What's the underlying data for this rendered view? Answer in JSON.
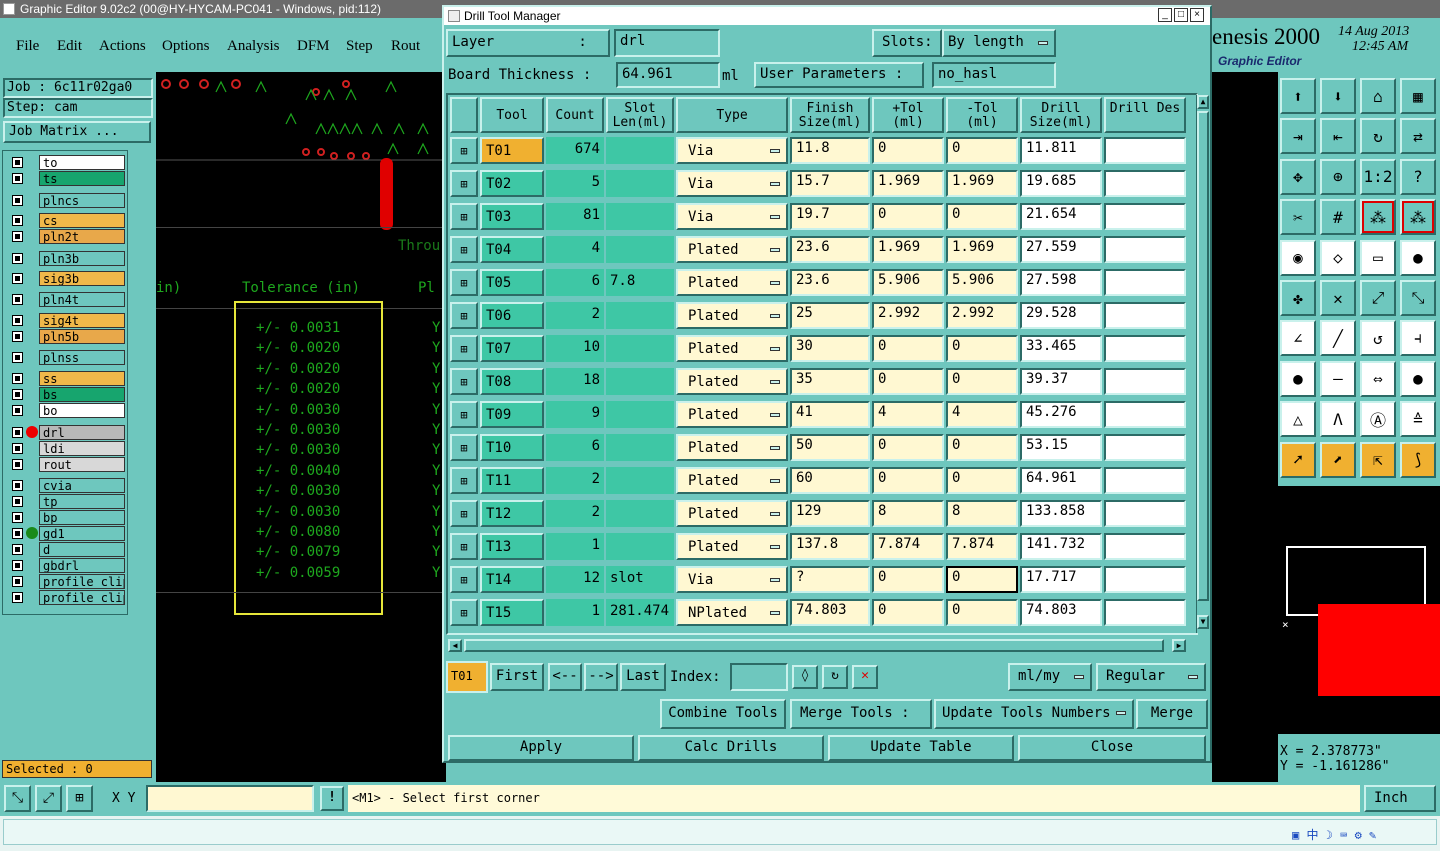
{
  "window": {
    "title": "Graphic Editor 9.02c2 (00@HY-HYCAM-PC041 - Windows, pid:112)"
  },
  "menu": [
    "File",
    "Edit",
    "Actions",
    "Options",
    "Analysis",
    "DFM",
    "Step",
    "Rout"
  ],
  "brand": {
    "name": "enesis 2000",
    "date": "14 Aug 2013",
    "time": "12:45 AM",
    "subtitle": "Graphic Editor"
  },
  "job": {
    "job_label": "Job : 6c11r02ga0",
    "step_label": "Step: cam",
    "matrix_button": "Job Matrix ..."
  },
  "layers": [
    {
      "name": "to",
      "color": "#ffffff"
    },
    {
      "name": "ts",
      "color": "#17a56e"
    },
    {
      "name": "plncs",
      "color": "#6ec7be"
    },
    {
      "name": "cs",
      "color": "#f0b84a"
    },
    {
      "name": "pln2t",
      "color": "#e8a84a"
    },
    {
      "name": "pln3b",
      "color": "#6ec7be"
    },
    {
      "name": "sig3b",
      "color": "#f0b84a"
    },
    {
      "name": "pln4t",
      "color": "#6ec7be"
    },
    {
      "name": "sig4t",
      "color": "#f0b84a"
    },
    {
      "name": "pln5b",
      "color": "#e8a84a"
    },
    {
      "name": "plnss",
      "color": "#6ec7be"
    },
    {
      "name": "ss",
      "color": "#f0b84a"
    },
    {
      "name": "bs",
      "color": "#17a56e"
    },
    {
      "name": "bo",
      "color": "#ffffff"
    },
    {
      "name": "drl",
      "color": "#b8b8b8"
    },
    {
      "name": "ldi",
      "color": "#d8d8d8"
    },
    {
      "name": "rout",
      "color": "#d8d8d8"
    },
    {
      "name": "cvia",
      "color": "#6ec7be"
    },
    {
      "name": "tp",
      "color": "#6ec7be"
    },
    {
      "name": "bp",
      "color": "#6ec7be"
    },
    {
      "name": "gd1",
      "color": "#6ec7be"
    },
    {
      "name": "d",
      "color": "#6ec7be"
    },
    {
      "name": "gbdrl",
      "color": "#6ec7be"
    },
    {
      "name": "profile_clip",
      "color": "#6ec7be"
    },
    {
      "name": "profile_clip",
      "color": "#6ec7be"
    }
  ],
  "selected": "Selected : 0",
  "canvas": {
    "header_left": "in)",
    "header_tol": "Tolerance (in)",
    "header_right": "Pl",
    "throu": "Throu",
    "tolerances": [
      "+/- 0.0031",
      "+/- 0.0020",
      "+/- 0.0020",
      "+/- 0.0020",
      "+/- 0.0030",
      "+/- 0.0030",
      "+/- 0.0030",
      "+/- 0.0040",
      "+/- 0.0030",
      "+/- 0.0030",
      "+/- 0.0080",
      "+/- 0.0079",
      "+/- 0.0059"
    ]
  },
  "dialog": {
    "title": "Drill Tool Manager",
    "layer_label": "Layer          :",
    "layer_value": "drl",
    "slots_label": "Slots:",
    "slots_value": "By length",
    "thickness_label": "Board Thickness :",
    "thickness_value": "64.961",
    "thickness_unit": "ml",
    "user_params_label": "User Parameters :",
    "user_params_value": "no_hasl",
    "columns": [
      "Tool",
      "Count",
      "Slot Len(ml)",
      "Type",
      "Finish Size(ml)",
      "+Tol (ml)",
      "-Tol (ml)",
      "Drill Size(ml)",
      "Drill Des"
    ],
    "rows": [
      {
        "tool": "T01",
        "count": "674",
        "slot": "",
        "type": "Via",
        "finish": "11.8",
        "ptol": "0",
        "mtol": "0",
        "drill": "11.811"
      },
      {
        "tool": "T02",
        "count": "5",
        "slot": "",
        "type": "Via",
        "finish": "15.7",
        "ptol": "1.969",
        "mtol": "1.969",
        "drill": "19.685"
      },
      {
        "tool": "T03",
        "count": "81",
        "slot": "",
        "type": "Via",
        "finish": "19.7",
        "ptol": "0",
        "mtol": "0",
        "drill": "21.654"
      },
      {
        "tool": "T04",
        "count": "4",
        "slot": "",
        "type": "Plated",
        "finish": "23.6",
        "ptol": "1.969",
        "mtol": "1.969",
        "drill": "27.559"
      },
      {
        "tool": "T05",
        "count": "6",
        "slot": "7.8",
        "type": "Plated",
        "finish": "23.6",
        "ptol": "5.906",
        "mtol": "5.906",
        "drill": "27.598"
      },
      {
        "tool": "T06",
        "count": "2",
        "slot": "",
        "type": "Plated",
        "finish": "25",
        "ptol": "2.992",
        "mtol": "2.992",
        "drill": "29.528"
      },
      {
        "tool": "T07",
        "count": "10",
        "slot": "",
        "type": "Plated",
        "finish": "30",
        "ptol": "0",
        "mtol": "0",
        "drill": "33.465"
      },
      {
        "tool": "T08",
        "count": "18",
        "slot": "",
        "type": "Plated",
        "finish": "35",
        "ptol": "0",
        "mtol": "0",
        "drill": "39.37"
      },
      {
        "tool": "T09",
        "count": "9",
        "slot": "",
        "type": "Plated",
        "finish": "41",
        "ptol": "4",
        "mtol": "4",
        "drill": "45.276"
      },
      {
        "tool": "T10",
        "count": "6",
        "slot": "",
        "type": "Plated",
        "finish": "50",
        "ptol": "0",
        "mtol": "0",
        "drill": "53.15"
      },
      {
        "tool": "T11",
        "count": "2",
        "slot": "",
        "type": "Plated",
        "finish": "60",
        "ptol": "0",
        "mtol": "0",
        "drill": "64.961"
      },
      {
        "tool": "T12",
        "count": "2",
        "slot": "",
        "type": "Plated",
        "finish": "129",
        "ptol": "8",
        "mtol": "8",
        "drill": "133.858"
      },
      {
        "tool": "T13",
        "count": "1",
        "slot": "",
        "type": "Plated",
        "finish": "137.8",
        "ptol": "7.874",
        "mtol": "7.874",
        "drill": "141.732"
      },
      {
        "tool": "T14",
        "count": "12",
        "slot": "slot",
        "type": "Via",
        "finish": "?",
        "ptol": "0",
        "mtol": "0",
        "drill": "17.717"
      },
      {
        "tool": "T15",
        "count": "1",
        "slot": "281.474",
        "type": "NPlated",
        "finish": "74.803",
        "ptol": "0",
        "mtol": "0",
        "drill": "74.803"
      }
    ],
    "nav": {
      "current": "T01",
      "first": "First",
      "prev": "<--",
      "next": "-->",
      "last": "Last",
      "index_label": "Index:",
      "units": "ml/my",
      "mode": "Regular"
    },
    "actions": {
      "combine": "Combine Tools",
      "merge_tools": "Merge Tools :",
      "update_numbers": "Update Tools Numbers",
      "merge": "Merge"
    },
    "footer": {
      "apply": "Apply",
      "calc": "Calc Drills",
      "update": "Update Table",
      "close": "Close"
    }
  },
  "coords": {
    "x": "X = 2.378773\"",
    "y": "Y = -1.161286\""
  },
  "statusbar": {
    "xy_label": "X Y :",
    "message": "<M1> - Select first corner",
    "units": "Inch"
  }
}
